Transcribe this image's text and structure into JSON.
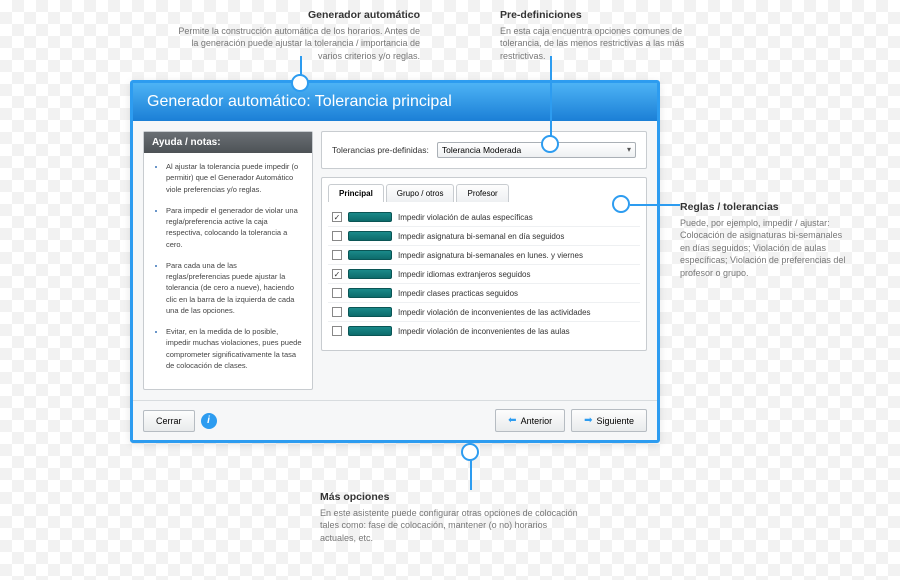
{
  "dialog": {
    "title": "Generador automático: Tolerancia principal",
    "help_header": "Ayuda / notas:",
    "help_items": [
      "Al ajustar la tolerancia puede impedir (o permitir) que el Generador Automático viole preferencias y/o reglas.",
      "Para impedir el generador de violar una regla/preferencia active la caja respectiva, colocando la tolerancia a cero.",
      "Para cada una de las reglas/preferencias puede ajustar la tolerancia (de cero a nueve), haciendo clic en la barra de la izquierda de cada una de las opciones.",
      "Evitar, en la medida de lo posible, impedir muchas violaciones, pues puede comprometer significativamente la tasa de colocación de clases."
    ],
    "predef_label": "Tolerancias pre-definidas:",
    "predef_value": "Tolerancia Moderada",
    "tabs": [
      "Principal",
      "Grupo / otros",
      "Profesor"
    ],
    "rules": [
      {
        "checked": true,
        "label": "Impedir violación de aulas específicas"
      },
      {
        "checked": false,
        "label": "Impedir asignatura bi-semanal en día seguidos"
      },
      {
        "checked": false,
        "label": "Impedir asignatura bi-semanales en lunes. y viernes"
      },
      {
        "checked": true,
        "label": "Impedir idiomas extranjeros seguidos"
      },
      {
        "checked": false,
        "label": "Impedir clases practicas seguidos"
      },
      {
        "checked": false,
        "label": "Impedir violación de inconvenientes de las actividades"
      },
      {
        "checked": false,
        "label": "Impedir violación de inconvenientes de las aulas"
      }
    ],
    "buttons": {
      "close": "Cerrar",
      "prev": "Anterior",
      "next": "Siguiente"
    }
  },
  "callouts": {
    "gen": {
      "title": "Generador automático",
      "body": "Permite la construcción automática de los horarios. Antes de la generación puede ajustar la tolerancia / importancia de varios criterios y/o reglas."
    },
    "pre": {
      "title": "Pre-definiciones",
      "body": "En esta caja encuentra opciones comunes de tolerancia, de las menos restrictivas a las más restrictivas."
    },
    "rules": {
      "title": "Reglas / tolerancias",
      "body": "Puede, por ejemplo, impedir / ajustar: Colocación de asignaturas bi-semanales en días seguidos; Violación de aulas específicas; Violación de preferencias del profesor o grupo."
    },
    "more": {
      "title": "Más opciones",
      "body": "En este asistente puede configurar otras opciones de colocación tales como: fase de colocación, mantener (o no) horarios actuales, etc."
    }
  }
}
